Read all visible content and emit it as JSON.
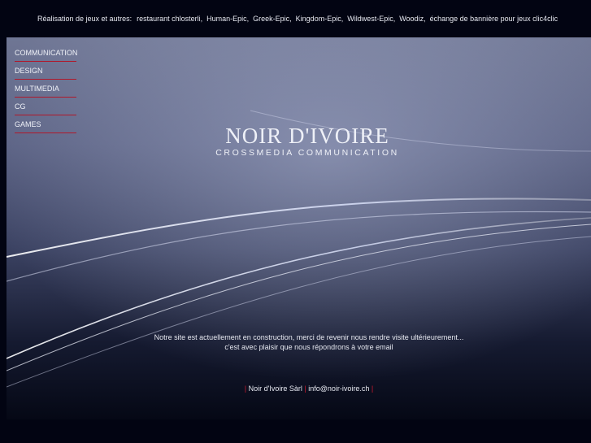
{
  "header": {
    "lead": "Réalisation de jeux et autres:",
    "links": [
      "restaurant chlosterli,",
      "Human-Epic,",
      "Greek-Epic,",
      "Kingdom-Epic,",
      "Wildwest-Epic,",
      "Woodiz,",
      "échange de bannière pour jeux clic4clic"
    ]
  },
  "nav": {
    "items": [
      "COMMUNICATION",
      "DESIGN",
      "MULTIMEDIA",
      "CG",
      "GAMES"
    ]
  },
  "logo": {
    "title": "NOIR D'IVOIRE",
    "subtitle": "CROSSMEDIA COMMUNICATION"
  },
  "message": {
    "line1": "Notre site est actuellement en construction, merci de revenir nous rendre visite ultérieurement...",
    "line2": "c'est avec plaisir que nous répondrons à votre email"
  },
  "footer": {
    "company": "Noir d'Ivoire Sàrl",
    "email": "info@noir-ivoire.ch",
    "separator": "|"
  },
  "colors": {
    "accent": "#d0192e",
    "background": "#020412"
  }
}
